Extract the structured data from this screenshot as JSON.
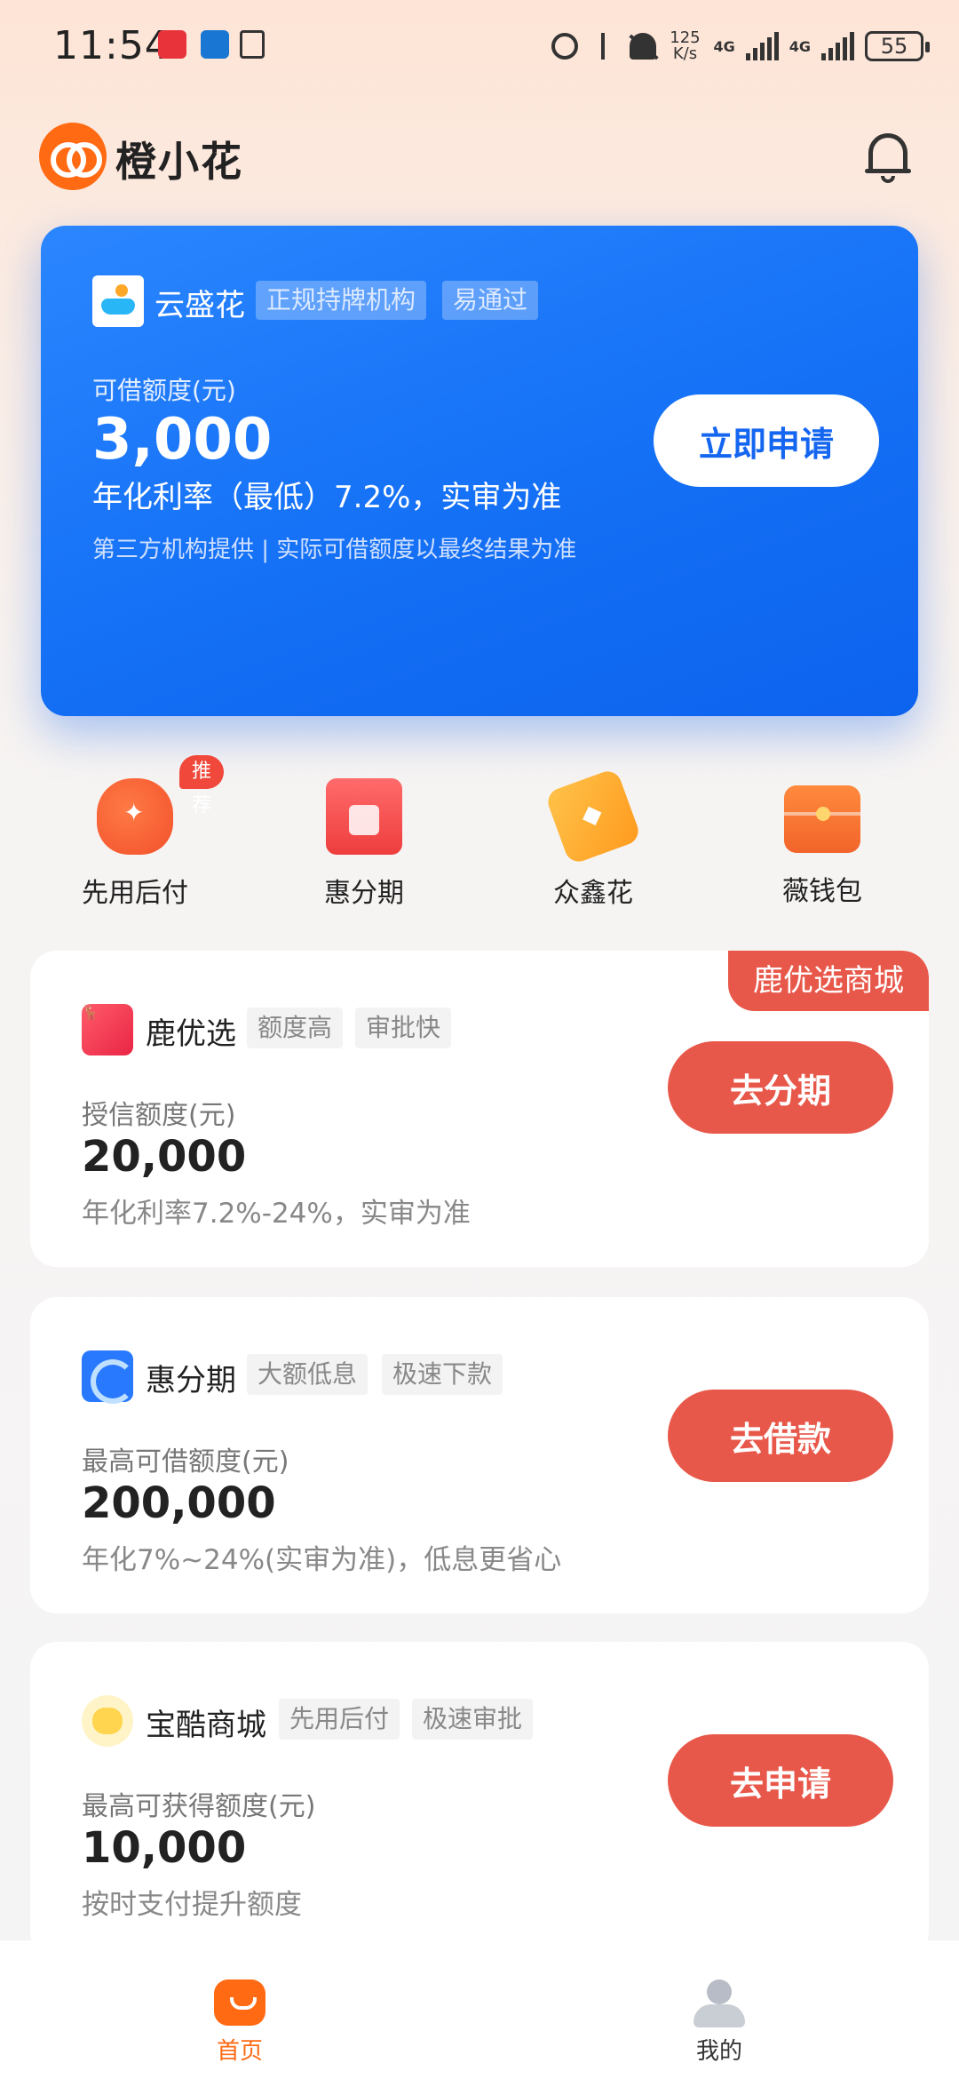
{
  "status_bar": {
    "time": "11:54",
    "net_speed": "125\nK/s",
    "net1": "4G",
    "net2": "4G",
    "battery": "55"
  },
  "header": {
    "app_name": "橙小花",
    "brand_color": "#ff6a13"
  },
  "hero": {
    "provider": "云盛花",
    "tags": [
      "正规持牌机构",
      "易通过"
    ],
    "limit_label": "可借额度(元)",
    "amount": "3,000",
    "rate": "年化利率（最低）7.2%，实审为准",
    "note": "第三方机构提供 | 实际可借额度以最终结果为准",
    "button": "立即申请",
    "color": "#1470f5"
  },
  "quick_entries": [
    {
      "label": "先用后付",
      "badge": "推荐",
      "icon": "money-bag-icon"
    },
    {
      "label": "惠分期",
      "icon": "gift-box-icon"
    },
    {
      "label": "众鑫花",
      "icon": "price-tag-icon"
    },
    {
      "label": "薇钱包",
      "icon": "wallet-icon"
    }
  ],
  "products": [
    {
      "name": "鹿优选",
      "tags": [
        "额度高",
        "审批快"
      ],
      "label": "授信额度(元)",
      "amount": "20,000",
      "desc": "年化利率7.2%-24%，实审为准",
      "button": "去分期",
      "corner": "鹿优选商城"
    },
    {
      "name": "惠分期",
      "tags": [
        "大额低息",
        "极速下款"
      ],
      "label": "最高可借额度(元)",
      "amount": "200,000",
      "desc": "年化7%~24%(实审为准)，低息更省心",
      "button": "去借款"
    },
    {
      "name": "宝酷商城",
      "tags": [
        "先用后付",
        "极速审批"
      ],
      "label": "最高可获得额度(元)",
      "amount": "10,000",
      "desc": "按时支付提升额度",
      "button": "去申请"
    }
  ],
  "bottom_nav": [
    {
      "label": "首页",
      "active": true
    },
    {
      "label": "我的",
      "active": false
    }
  ],
  "accent_colors": {
    "button_red": "#e8584a",
    "active_orange": "#ff6a13"
  }
}
